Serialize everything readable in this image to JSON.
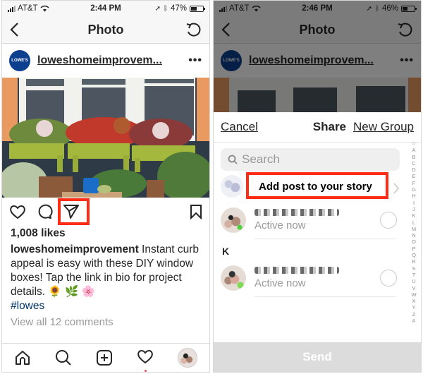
{
  "left": {
    "status": {
      "carrier": "AT&T",
      "time": "2:44 PM",
      "battery": "47%",
      "battery_level": 0.47
    },
    "nav": {
      "title": "Photo"
    },
    "post": {
      "username": "loweshomeimprovem...",
      "logo_text": "LOWE'S",
      "more": "•••",
      "likes": "1,008 likes",
      "caption_user": "loweshomeimprovement",
      "caption_text": " Instant curb appeal is easy with these DIY window boxes! Tap the link in bio for project details. 🌻 🌿 🌸",
      "hashtag": "#lowes",
      "view_comments": "View all 12 comments"
    },
    "tabbar": {
      "items": [
        "home-icon",
        "search-icon",
        "add-post-icon",
        "activity-heart-icon",
        "profile-avatar"
      ]
    }
  },
  "right": {
    "status": {
      "carrier": "AT&T",
      "time": "2:46 PM",
      "battery": "46%",
      "battery_level": 0.46
    },
    "nav": {
      "title": "Photo"
    },
    "post": {
      "username": "loweshomeimprovem...",
      "logo_text": "LOWE'S",
      "more": "•••"
    },
    "sheet": {
      "cancel": "Cancel",
      "title": "Share",
      "new_group": "New Group",
      "search_placeholder": "Search",
      "story_label": "Add post to your story",
      "section_letter": "K",
      "contacts": [
        {
          "status": "Active now"
        },
        {
          "status": "Active now"
        }
      ],
      "index_letters": [
        "☆",
        "A",
        "B",
        "C",
        "D",
        "E",
        "F",
        "G",
        "H",
        "I",
        "J",
        "K",
        "L",
        "M",
        "N",
        "O",
        "P",
        "Q",
        "R",
        "S",
        "T",
        "U",
        "V",
        "W",
        "X",
        "Y",
        "Z",
        "#"
      ],
      "send": "Send"
    }
  },
  "colors": {
    "highlight": "#ff2d16",
    "hashtag": "#003569",
    "lowes_blue": "#0d3f8f"
  }
}
